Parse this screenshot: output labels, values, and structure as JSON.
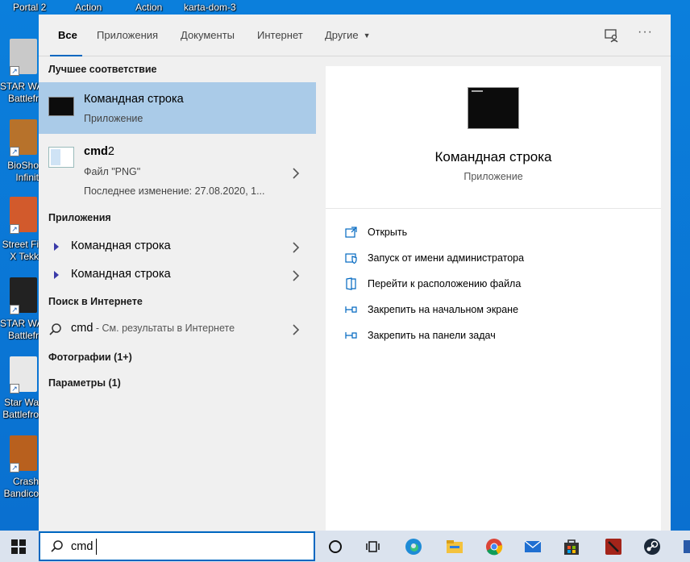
{
  "desktop": {
    "top_labels": [
      "Portal 2",
      "Action",
      "Action",
      "karta-dom-3"
    ],
    "icons": [
      {
        "label_1": "STAR WA",
        "label_2": "Battlefr",
        "color": "#c9c9c9"
      },
      {
        "label_1": "BioSho",
        "label_2": "Infinit",
        "color": "#b7722b"
      },
      {
        "label_1": "Street Fi",
        "label_2": "X Tekk",
        "color": "#d25a2c"
      },
      {
        "label_1": "STAR WA",
        "label_2": "Battlefr",
        "color": "#222222"
      },
      {
        "label_1": "Star Wa",
        "label_2": "Battlefro",
        "color": "#e8e8e8"
      },
      {
        "label_1": "Crash",
        "label_2": "Bandico",
        "color": "#b8601e"
      }
    ]
  },
  "tabs": [
    {
      "label": "Все",
      "active": true
    },
    {
      "label": "Приложения"
    },
    {
      "label": "Документы"
    },
    {
      "label": "Интернет"
    },
    {
      "label": "Другие"
    }
  ],
  "left": {
    "best_match_header": "Лучшее соответствие",
    "best_match": {
      "title": "Командная строка",
      "subtitle": "Приложение"
    },
    "file_result": {
      "name_bold": "cmd",
      "name_rest": "2",
      "type": "Файл \"PNG\"",
      "modified": "Последнее изменение: 27.08.2020, 1..."
    },
    "apps_header": "Приложения",
    "apps": [
      "Командная строка",
      "Командная строка"
    ],
    "web_header": "Поиск в Интернете",
    "web_query": "cmd",
    "web_hint": " - См. результаты в Интернете",
    "photos_header": "Фотографии (1+)",
    "settings_header": "Параметры (1)"
  },
  "preview": {
    "title": "Командная строка",
    "subtitle": "Приложение",
    "actions": [
      {
        "label": "Открыть",
        "icon": "open-icon"
      },
      {
        "label": "Запуск от имени администратора",
        "icon": "shield-icon"
      },
      {
        "label": "Перейти к расположению файла",
        "icon": "file-location-icon"
      },
      {
        "label": "Закрепить на начальном экране",
        "icon": "pin-icon"
      },
      {
        "label": "Закрепить на панели задач",
        "icon": "pin-icon"
      }
    ]
  },
  "taskbar": {
    "search_value": "cmd",
    "apps": [
      "cortana-icon",
      "task-view-icon",
      "edge-icon",
      "file-explorer-icon",
      "chrome-icon",
      "mail-icon",
      "store-icon",
      "dota-icon",
      "steam-icon"
    ]
  },
  "colors": {
    "accent": "#0067c0",
    "selection": "#aacbe8",
    "desktop": "#0a78d7",
    "action_icon": "#0067c0"
  }
}
